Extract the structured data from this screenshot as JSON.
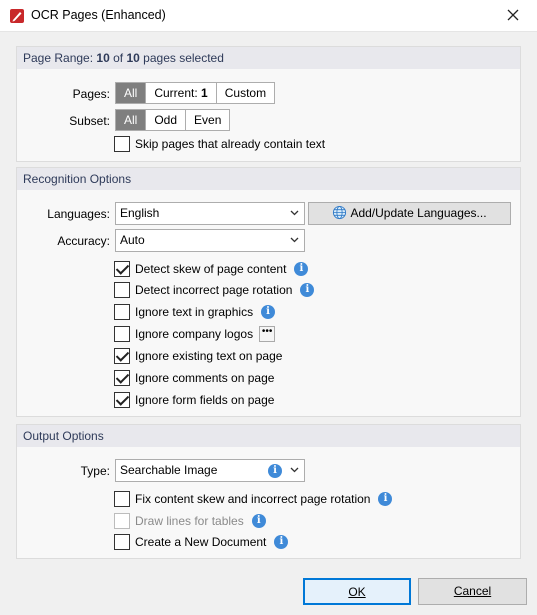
{
  "window": {
    "title": "OCR Pages (Enhanced)"
  },
  "page_range": {
    "header_prefix": "Page Range:",
    "selected_count": "10",
    "of_text": "of",
    "total_count": "10",
    "suffix": "pages selected",
    "pages_label": "Pages:",
    "pages_options": [
      "All",
      "Current:",
      "Custom"
    ],
    "current_page": "1",
    "subset_label": "Subset:",
    "subset_options": [
      "All",
      "Odd",
      "Even"
    ],
    "skip_label": "Skip pages that already contain text"
  },
  "recognition": {
    "header": "Recognition Options",
    "languages_label": "Languages:",
    "language_value": "English",
    "add_languages_button": "Add/Update Languages...",
    "accuracy_label": "Accuracy:",
    "accuracy_value": "Auto",
    "options": [
      {
        "label": "Detect skew of page content",
        "checked": true
      },
      {
        "label": "Detect incorrect page rotation",
        "checked": false
      },
      {
        "label": "Ignore text in graphics",
        "checked": false
      },
      {
        "label": "Ignore company logos",
        "checked": false
      },
      {
        "label": "Ignore existing text on page",
        "checked": true
      },
      {
        "label": "Ignore comments on page",
        "checked": true
      },
      {
        "label": "Ignore form fields on page",
        "checked": true
      }
    ],
    "dots_button": "•••"
  },
  "output": {
    "header": "Output Options",
    "type_label": "Type:",
    "type_value": "Searchable Image",
    "options": [
      {
        "label": "Fix content skew and incorrect page rotation",
        "checked": false,
        "disabled": false
      },
      {
        "label": "Draw lines for tables",
        "checked": false,
        "disabled": true
      },
      {
        "label": "Create a New Document",
        "checked": false,
        "disabled": false
      }
    ]
  },
  "footer": {
    "ok_label": "OK",
    "cancel_label": "Cancel"
  },
  "colors": {
    "accent_info": "#3f8ad8",
    "active_segment": "#7f7f7f",
    "app_icon_red": "#c8282a"
  },
  "icons": [
    "app-logo-icon",
    "close-icon",
    "info-icon",
    "chevron-down-icon",
    "globe-icon",
    "more-dots-icon",
    "checkmark-icon"
  ]
}
